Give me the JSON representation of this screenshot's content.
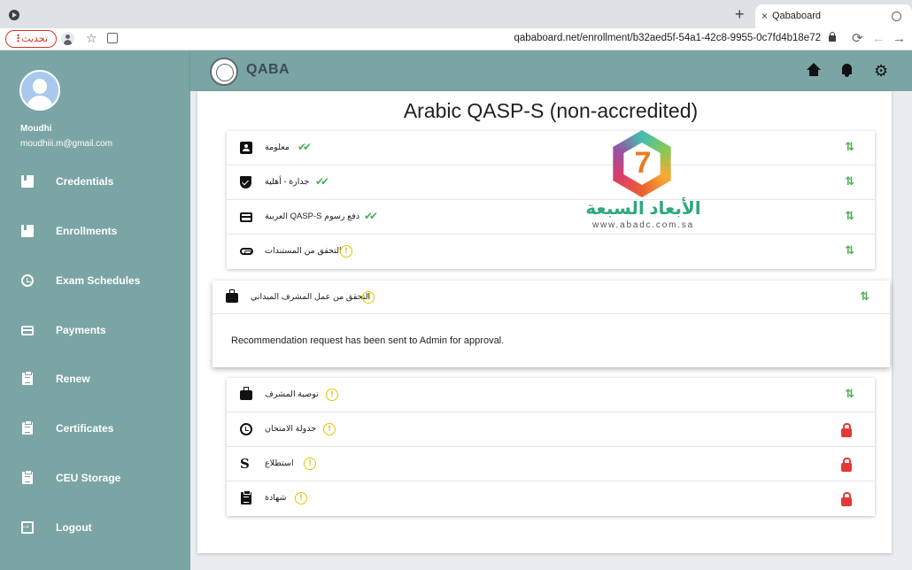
{
  "browser": {
    "tab_title": "Qababoard",
    "new_tab_icon": "+",
    "tab_close_icon": "×",
    "update_button": "تحديث",
    "url": "qababoard.net/enrollment/b32aed5f-54a1-42c8-9955-0c7fd4b18e72",
    "reload_icon": "⟳",
    "back_icon": "←",
    "forward_icon": "→"
  },
  "user": {
    "name": "Moudhi",
    "email": "moudhiii.m@gmail.com"
  },
  "sidebar": {
    "items": [
      {
        "label": "Credentials",
        "icon": "book-icon"
      },
      {
        "label": "Enrollments",
        "icon": "book-icon"
      },
      {
        "label": "Exam Schedules",
        "icon": "clock-icon"
      },
      {
        "label": "Payments",
        "icon": "credit-card-icon"
      },
      {
        "label": "Renew",
        "icon": "clipboard-icon"
      },
      {
        "label": "Certificates",
        "icon": "clipboard-icon"
      },
      {
        "label": "CEU Storage",
        "icon": "clipboard-icon"
      },
      {
        "label": "Logout",
        "icon": "logout-icon"
      }
    ]
  },
  "header": {
    "logo_text": "QABA",
    "gear_glyph": "⚙"
  },
  "page": {
    "title": "Arabic QASP-S (non-accredited)"
  },
  "steps_top": [
    {
      "label": "معلومة",
      "status": "done",
      "action": "expand"
    },
    {
      "label": "جدارة - أهلية",
      "status": "done",
      "action": "expand"
    },
    {
      "label": "دفع رسوم QASP-S العربية",
      "status": "done",
      "action": "expand"
    },
    {
      "label": "التحقق من المستندات",
      "status": "pending",
      "action": "expand"
    }
  ],
  "expanded_step": {
    "label": "التحقق من عمل المشرف الميداني",
    "status": "pending",
    "action": "expand",
    "message": "Recommendation request has been sent to Admin for approval."
  },
  "steps_bottom": [
    {
      "label": "توصية المشرف",
      "status": "pending",
      "action": "expand"
    },
    {
      "label": "جدولة الامتحان",
      "status": "pending",
      "action": "locked"
    },
    {
      "label": "استطلاع",
      "status": "pending",
      "action": "locked"
    },
    {
      "label": "شهادة",
      "status": "pending",
      "action": "locked"
    }
  ],
  "glyphs": {
    "done": "✔✔",
    "pending": "!",
    "expand": "⇅",
    "s_letter": "S"
  },
  "watermark": {
    "arabic": "الأبعاد السبعة",
    "url": "www.abadc.com.sa"
  },
  "colors": {
    "sidebar": "#7aa5a4",
    "done": "#4caf50",
    "pending": "#e0c800",
    "locked": "#e53935"
  }
}
